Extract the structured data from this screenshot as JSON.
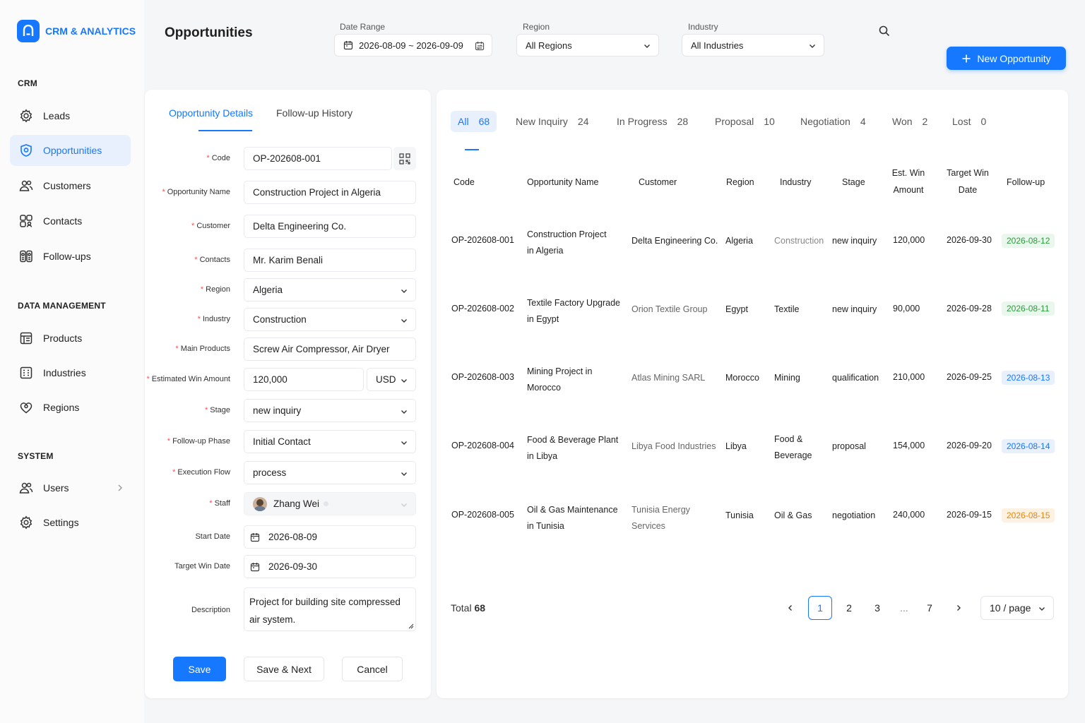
{
  "app": {
    "title": "CRM & ANALYTICS"
  },
  "sidebar": {
    "sections": [
      {
        "title": "CRM"
      },
      {
        "title": "DATA MANAGEMENT"
      },
      {
        "title": "SYSTEM"
      }
    ],
    "items": [
      {
        "label": "Leads",
        "icon": "gear-icon"
      },
      {
        "label": "Opportunities",
        "icon": "shield-icon"
      },
      {
        "label": "Customers",
        "icon": "users-icon"
      },
      {
        "label": "Contacts",
        "icon": "contacts-icon"
      },
      {
        "label": "Follow-ups",
        "icon": "follow-up-icon"
      },
      {
        "label": "Products",
        "icon": "products-icon"
      },
      {
        "label": "Industries",
        "icon": "industries-icon"
      },
      {
        "label": "Regions",
        "icon": "regions-icon"
      },
      {
        "label": "Users",
        "icon": "users-icon"
      },
      {
        "label": "Settings",
        "icon": "settings-icon"
      }
    ]
  },
  "header": {
    "title": "Opportunities",
    "date_range": {
      "label": "Date Range",
      "value": "2026-08-09 ~ 2026-09-09"
    },
    "region": {
      "label": "Region",
      "value": "All Regions"
    },
    "industry": {
      "label": "Industry",
      "value": "All Industries"
    },
    "new_button": "New Opportunity"
  },
  "form": {
    "tabs": [
      "Opportunity Details",
      "Follow-up History"
    ],
    "fields": {
      "code": {
        "label": "Code",
        "value": "OP-202608-001"
      },
      "name": {
        "label": "Opportunity Name",
        "value": "Construction Project in Algeria"
      },
      "customer": {
        "label": "Customer",
        "value": "Delta Engineering Co."
      },
      "contacts": {
        "label": "Contacts",
        "value": "Mr. Karim Benali"
      },
      "region": {
        "label": "Region",
        "value": "Algeria"
      },
      "industry": {
        "label": "Industry",
        "value": "Construction"
      },
      "products": {
        "label": "Main Products",
        "value": "Screw Air Compressor, Air Dryer"
      },
      "amount": {
        "label": "Estimated Win Amount",
        "value": "120,000",
        "currency": "USD"
      },
      "stage": {
        "label": "Stage",
        "value": "new inquiry"
      },
      "phase": {
        "label": "Follow-up Phase",
        "value": "Initial Contact"
      },
      "flow": {
        "label": "Execution Flow",
        "value": "process"
      },
      "staff": {
        "label": "Staff",
        "value": "Zhang Wei"
      },
      "start": {
        "label": "Start Date",
        "value": "2026-08-09"
      },
      "target": {
        "label": "Target Win Date",
        "value": "2026-09-30"
      },
      "description": {
        "label": "Description",
        "line1": "Project for building site compressed",
        "line2": "air system."
      }
    },
    "buttons": {
      "save": "Save",
      "save_next": "Save & Next",
      "cancel": "Cancel"
    }
  },
  "list": {
    "status_tabs": [
      {
        "label": "All",
        "count": "68"
      },
      {
        "label": "New Inquiry",
        "count": "24"
      },
      {
        "label": "In Progress",
        "count": "28"
      },
      {
        "label": "Proposal",
        "count": "10"
      },
      {
        "label": "Negotiation",
        "count": "4"
      },
      {
        "label": "Won",
        "count": "2"
      },
      {
        "label": "Lost",
        "count": "0"
      }
    ],
    "columns": {
      "code": "Code",
      "name": "Opportunity Name",
      "customer": "Customer",
      "region": "Region",
      "industry": "Industry",
      "stage": "Stage",
      "amount_1": "Est. Win",
      "amount_2": "Amount",
      "target_1": "Target Win",
      "target_2": "Date",
      "followup": "Follow-up"
    },
    "rows": [
      {
        "code": "OP-202608-001",
        "name1": "Construction Project",
        "name2": "in Algeria",
        "customer1": "Delta Engineering Co.",
        "customer2": "",
        "region": "Algeria",
        "industry1": "Construction",
        "industry2": "",
        "stage": "new inquiry",
        "amount": "120,000",
        "target": "2026-09-30",
        "followup": "2026-08-12",
        "fu_color": "#2e9a3e",
        "fu_bg": "#eaf7ec"
      },
      {
        "code": "OP-202608-002",
        "name1": "Textile Factory Upgrade",
        "name2": "in Egypt",
        "customer1": "Orion Textile Group",
        "customer2": "",
        "region": "Egypt",
        "industry1": "Textile",
        "industry2": "",
        "stage": "new inquiry",
        "amount": "90,000",
        "target": "2026-09-28",
        "followup": "2026-08-11",
        "fu_color": "#2e9a3e",
        "fu_bg": "#eaf7ec"
      },
      {
        "code": "OP-202608-003",
        "name1": "Mining Project in",
        "name2": "Morocco",
        "customer1": "Atlas Mining SARL",
        "customer2": "",
        "region": "Morocco",
        "industry1": "Mining",
        "industry2": "",
        "stage": "qualification",
        "amount": "210,000",
        "target": "2026-09-25",
        "followup": "2026-08-13",
        "fu_color": "#1677ff",
        "fu_bg": "#e8f0fd"
      },
      {
        "code": "OP-202608-004",
        "name1": "Food & Beverage Plant",
        "name2": "in Libya",
        "customer1": "Libya Food Industries",
        "customer2": "",
        "region": "Libya",
        "industry1": "Food &",
        "industry2": "Beverage",
        "stage": "proposal",
        "amount": "154,000",
        "target": "2026-09-20",
        "followup": "2026-08-14",
        "fu_color": "#1677ff",
        "fu_bg": "#e8f0fd"
      },
      {
        "code": "OP-202608-005",
        "name1": "Oil & Gas Maintenance",
        "name2": "in Tunisia",
        "customer1": "Tunisia Energy",
        "customer2": "Services",
        "region": "Tunisia",
        "industry1": "Oil & Gas",
        "industry2": "",
        "stage": "negotiation",
        "amount": "240,000",
        "target": "2026-09-15",
        "followup": "2026-08-15",
        "fu_color": "#e8860c",
        "fu_bg": "#fdf1e2"
      }
    ],
    "total_label": "Total",
    "total": "68",
    "pagination": {
      "pages": [
        "1",
        "2",
        "3",
        "...",
        "7"
      ],
      "current": "1",
      "page_size": "10 / page"
    }
  }
}
